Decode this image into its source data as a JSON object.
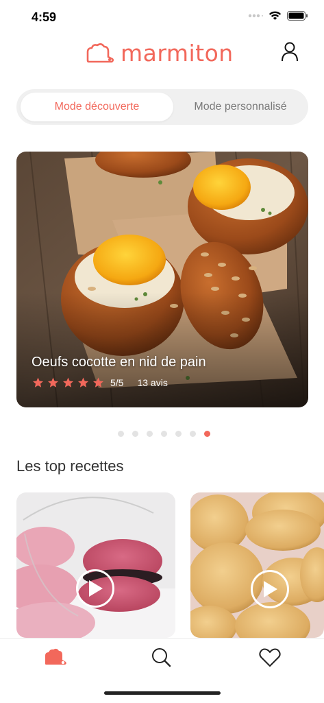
{
  "status_bar": {
    "time": "4:59"
  },
  "header": {
    "logo_text": "marmiton"
  },
  "mode_switch": {
    "active_label": "Mode découverte",
    "inactive_label": "Mode personnalisé"
  },
  "hero": {
    "title": "Oeufs cocotte en nid de pain",
    "rating": 5,
    "rating_text": "5/5",
    "reviews": "13 avis",
    "carousel_pages": 7,
    "carousel_active": 7
  },
  "top_recipes": {
    "title": "Les top recettes",
    "cards": [
      {
        "image": "macarons-photo",
        "icon": "play-icon"
      },
      {
        "image": "cookies-photo",
        "icon": "play-icon"
      }
    ]
  },
  "tab_bar": {
    "items": [
      {
        "icon": "chef-hat-icon",
        "active": true
      },
      {
        "icon": "search-icon",
        "active": false
      },
      {
        "icon": "heart-icon",
        "active": false
      }
    ]
  },
  "colors": {
    "accent": "#f2685b",
    "inactive_text": "#7a7a7a",
    "switch_bg": "#f0f0f0"
  }
}
